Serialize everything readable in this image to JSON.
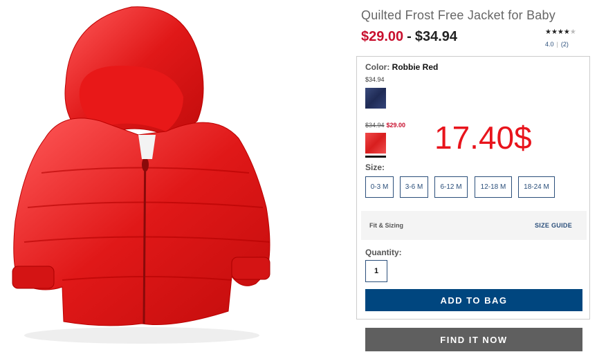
{
  "product": {
    "title": "Quilted Frost Free Jacket for Baby",
    "price_sale": "$29.00",
    "price_separator": "-",
    "price_regular": "$34.94",
    "image_name": "red-puffer-jacket-image"
  },
  "rating": {
    "stars_filled": "★★★★",
    "stars_empty": "★",
    "value": 4.0,
    "value_label": "4.0",
    "divider": "|",
    "count_label": "(2)"
  },
  "color": {
    "label": "Color:",
    "selected": "Robbie Red",
    "swatches": [
      {
        "name": "navy",
        "price": "$34.94",
        "color": "#26315e"
      },
      {
        "name": "red",
        "price_regular": "$34.94",
        "price_sale": "$29.00",
        "color": "#e52a2a",
        "selected": true
      }
    ]
  },
  "annotation": {
    "text": "17.40$",
    "color": "#e8141c"
  },
  "size": {
    "label": "Size:",
    "options": [
      "0-3 M",
      "3-6 M",
      "6-12 M",
      "12-18 M",
      "18-24 M"
    ]
  },
  "fit": {
    "label": "Fit & Sizing",
    "guide_label": "SIZE GUIDE"
  },
  "quantity": {
    "label": "Quantity:",
    "value": "1"
  },
  "actions": {
    "add_to_bag": "ADD TO BAG",
    "find_it_now": "FIND IT NOW"
  },
  "colors": {
    "accent": "#00467f",
    "sale": "#c8102e",
    "secondary_button": "#5f5f5f"
  }
}
